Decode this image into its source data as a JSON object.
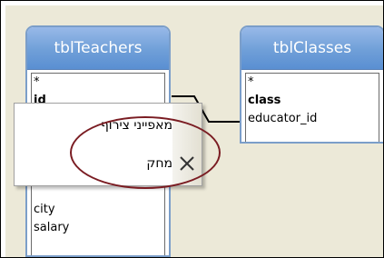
{
  "tables": [
    {
      "title": "tblTeachers",
      "fields": [
        {
          "label": "*",
          "key": false
        },
        {
          "label": "id",
          "key": true
        },
        {
          "label": "city",
          "key": false
        },
        {
          "label": "salary",
          "key": false
        }
      ]
    },
    {
      "title": "tblClasses",
      "fields": [
        {
          "label": "*",
          "key": false
        },
        {
          "label": "class",
          "key": true
        },
        {
          "label": "educator_id",
          "key": false
        }
      ]
    }
  ],
  "context_menu": {
    "items": [
      {
        "label": "מאפייני צירוף",
        "icon": ""
      },
      {
        "label": "מחק",
        "icon": "delete-x-icon"
      }
    ]
  },
  "colors": {
    "title_bar": "#6f9fd8",
    "highlight_circle": "#7a1c22"
  }
}
